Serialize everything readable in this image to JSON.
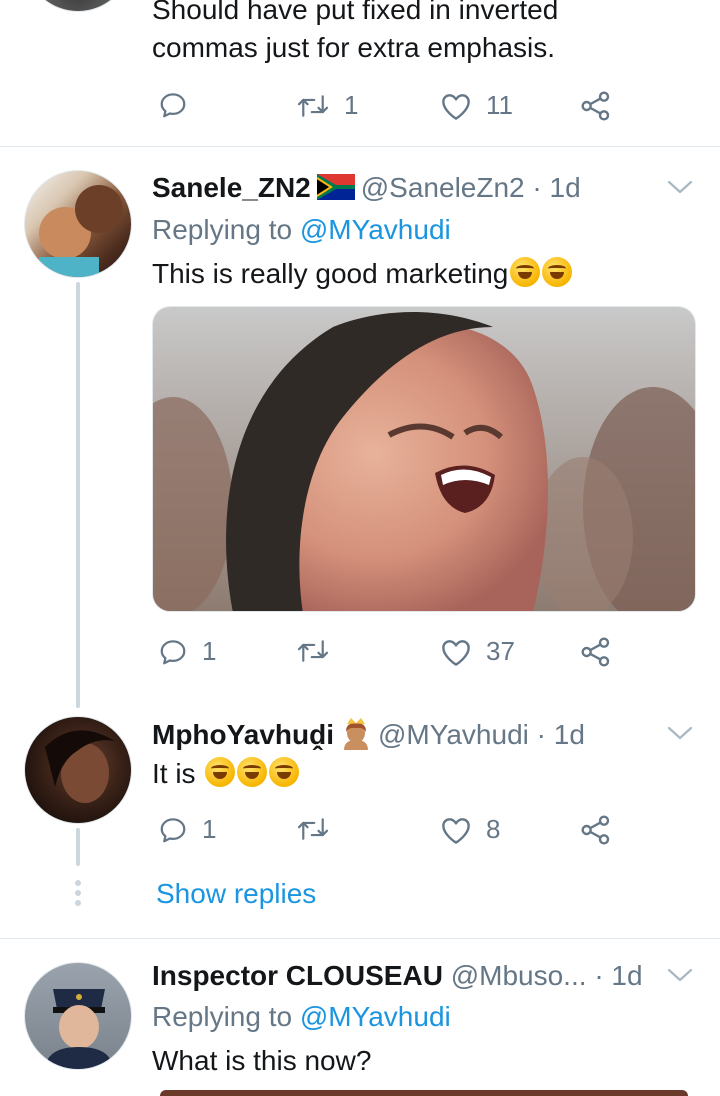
{
  "top_tweet": {
    "text_line1": "Should have put fixed in inverted",
    "text_line2": "commas just for extra emphasis.",
    "retweets": "1",
    "likes": "11"
  },
  "tweet_sanele": {
    "display_name": "Sanele_ZN2",
    "handle": "@SaneleZn2",
    "time": "· 1d",
    "replying_prefix": "Replying to ",
    "replying_to": "@MYavhudi",
    "text": "This is really good marketing",
    "replies": "1",
    "likes": "37"
  },
  "tweet_mpho": {
    "display_name": "MphoYavhuḓi",
    "handle": "@MYavhudi",
    "time": "· 1d",
    "text": "It is",
    "replies": "1",
    "likes": "8",
    "show_replies": "Show replies"
  },
  "tweet_inspector": {
    "display_name": "Inspector CLOUSEAU",
    "handle": "@Mbuso...",
    "time": "· 1d",
    "replying_prefix": "Replying to ",
    "replying_to": "@MYavhudi",
    "text": "What is this now?"
  },
  "icons": {
    "reply": "reply-icon",
    "retweet": "retweet-icon",
    "like": "heart-icon",
    "share": "share-icon",
    "caret": "chevron-down-icon",
    "emoji": "rolling-on-floor-laughing-emoji",
    "flag": "south-africa-flag-emoji",
    "crown": "princess-emoji"
  },
  "colors": {
    "text": "#14171a",
    "muted": "#657786",
    "link": "#1b95e0",
    "divider": "#e1e8ed",
    "thread_line": "#ccd6dd"
  }
}
